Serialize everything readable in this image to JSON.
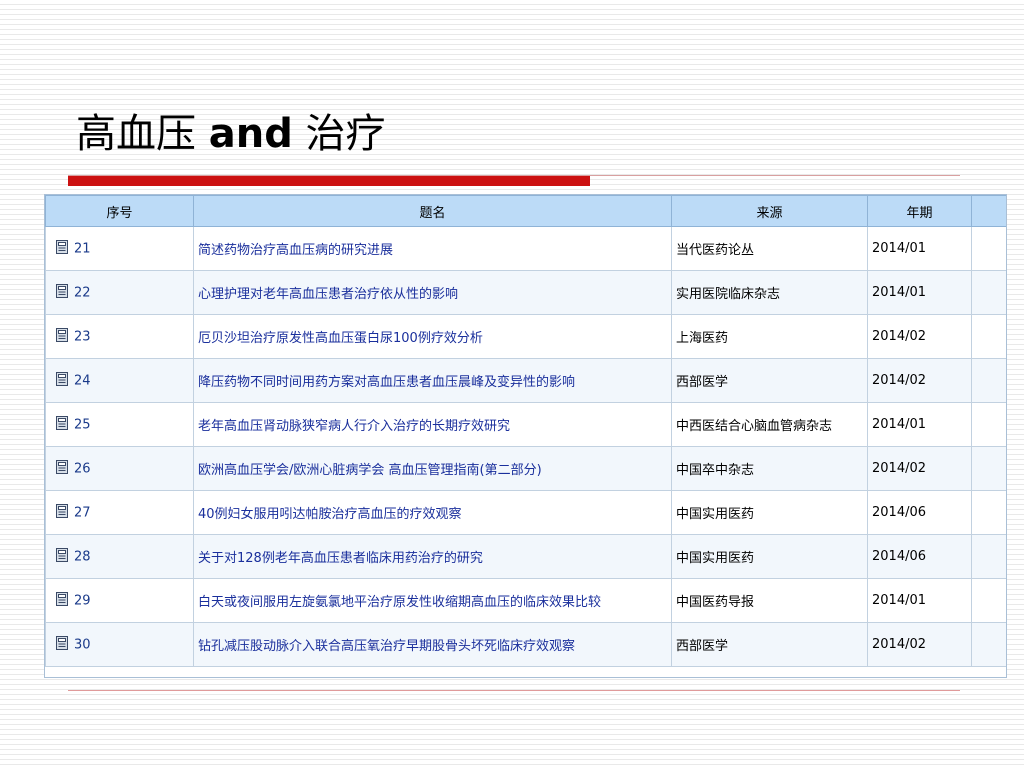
{
  "slide": {
    "title_cn_1": "高血压",
    "title_en": "and",
    "title_cn_2": "治疗"
  },
  "colors": {
    "accent_red": "#cc1111",
    "header_bg": "#bcdbf7",
    "link_blue": "#1a2f9c"
  },
  "table": {
    "headers": [
      "序号",
      "题名",
      "来源",
      "年期",
      ""
    ],
    "row_icon": "document-icon",
    "rows": [
      {
        "no": "21",
        "title": "简述药物治疗高血压病的研究进展",
        "source": "当代医药论丛",
        "year": "2014/01"
      },
      {
        "no": "22",
        "title": "心理护理对老年高血压患者治疗依从性的影响",
        "source": "实用医院临床杂志",
        "year": "2014/01"
      },
      {
        "no": "23",
        "title": "厄贝沙坦治疗原发性高血压蛋白尿100例疗效分析",
        "source": "上海医药",
        "year": "2014/02"
      },
      {
        "no": "24",
        "title": "降压药物不同时间用药方案对高血压患者血压晨峰及变异性的影响",
        "source": "西部医学",
        "year": "2014/02"
      },
      {
        "no": "25",
        "title": "老年高血压肾动脉狭窄病人行介入治疗的长期疗效研究",
        "source": "中西医结合心脑血管病杂志",
        "year": "2014/01"
      },
      {
        "no": "26",
        "title": "欧洲高血压学会/欧洲心脏病学会 高血压管理指南(第二部分)",
        "source": "中国卒中杂志",
        "year": "2014/02"
      },
      {
        "no": "27",
        "title": "40例妇女服用吲达帕胺治疗高血压的疗效观察",
        "source": "中国实用医药",
        "year": "2014/06"
      },
      {
        "no": "28",
        "title": "关于对128例老年高血压患者临床用药治疗的研究",
        "source": "中国实用医药",
        "year": "2014/06"
      },
      {
        "no": "29",
        "title": "白天或夜间服用左旋氨氯地平治疗原发性收缩期高血压的临床效果比较",
        "source": "中国医药导报",
        "year": "2014/01"
      },
      {
        "no": "30",
        "title": "钻孔减压股动脉介入联合高压氧治疗早期股骨头坏死临床疗效观察",
        "source": "西部医学",
        "year": "2014/02"
      }
    ]
  }
}
